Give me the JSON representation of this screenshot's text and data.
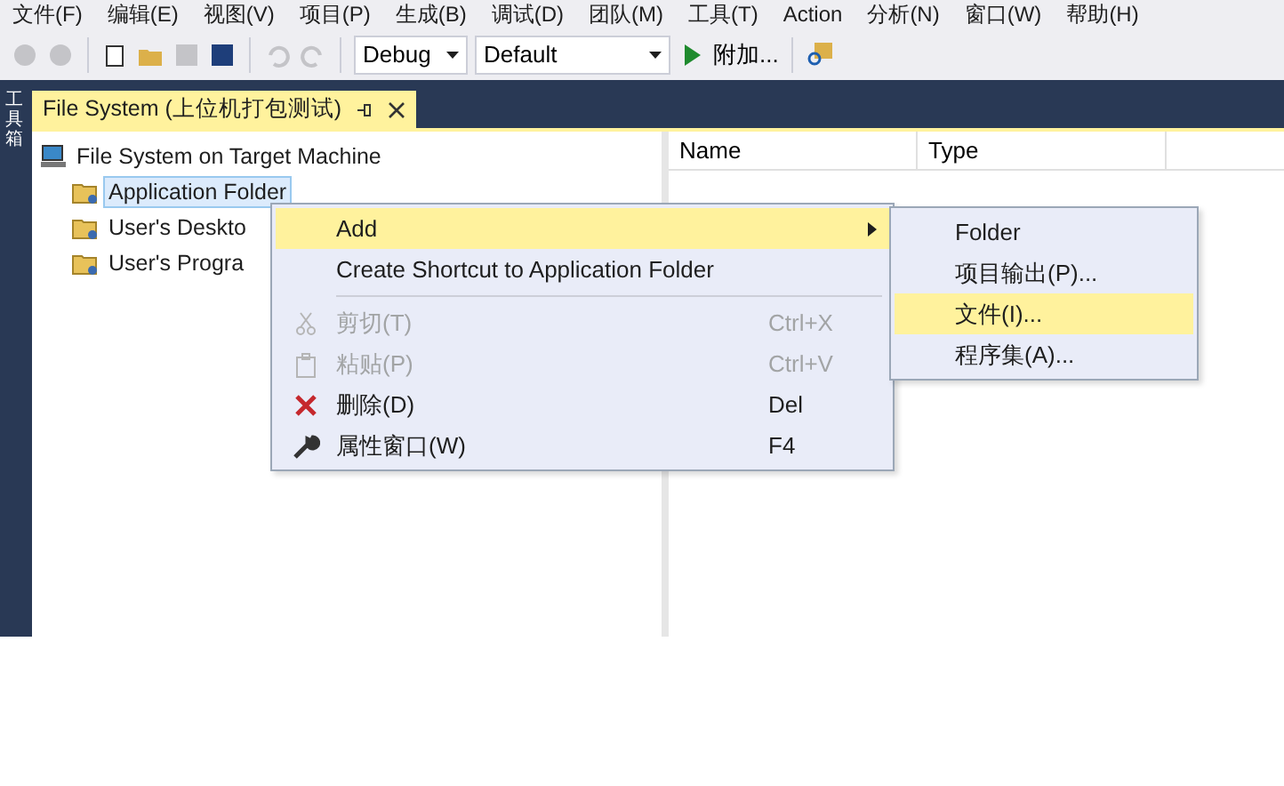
{
  "menu_bar": [
    "文件(F)",
    "编辑(E)",
    "视图(V)",
    "项目(P)",
    "生成(B)",
    "调试(D)",
    "团队(M)",
    "工具(T)",
    "Action",
    "分析(N)",
    "窗口(W)",
    "帮助(H)"
  ],
  "toolbar": {
    "configuration": "Debug",
    "platform": "Default",
    "start_button": "附加..."
  },
  "side_strip": "工具箱",
  "document_tab": {
    "title": "File System (上位机打包测试)",
    "selected": true
  },
  "tree": {
    "label": "File System on Target Machine",
    "children": [
      {
        "label": "Application Folder",
        "selected": true
      },
      {
        "label": "User's Deskto",
        "selected": false
      },
      {
        "label": "User's Progra",
        "selected": false
      }
    ]
  },
  "list_columns": [
    "Name",
    "Type"
  ],
  "context_menu": [
    {
      "kind": "item",
      "label": "Add",
      "has_submenu": true,
      "disabled": false,
      "selected": true
    },
    {
      "kind": "item",
      "label": "Create Shortcut to Application Folder",
      "has_submenu": false,
      "disabled": false,
      "selected": false
    },
    {
      "kind": "separator"
    },
    {
      "kind": "item",
      "label": "剪切(T)",
      "shortcut": "Ctrl+X",
      "has_submenu": false,
      "disabled": true,
      "selected": false
    },
    {
      "kind": "item",
      "label": "粘贴(P)",
      "shortcut": "Ctrl+V",
      "has_submenu": false,
      "disabled": true,
      "selected": false
    },
    {
      "kind": "item",
      "label": "删除(D)",
      "shortcut": "Del",
      "has_submenu": false,
      "disabled": false,
      "selected": false
    },
    {
      "kind": "item",
      "label": "属性窗口(W)",
      "shortcut": "F4",
      "has_submenu": false,
      "disabled": false,
      "selected": false
    }
  ],
  "submenu": [
    {
      "label": "Folder",
      "selected": false
    },
    {
      "label": "项目输出(P)...",
      "selected": false
    },
    {
      "label": "文件(I)...",
      "selected": true
    },
    {
      "label": "程序集(A)...",
      "selected": false
    }
  ]
}
